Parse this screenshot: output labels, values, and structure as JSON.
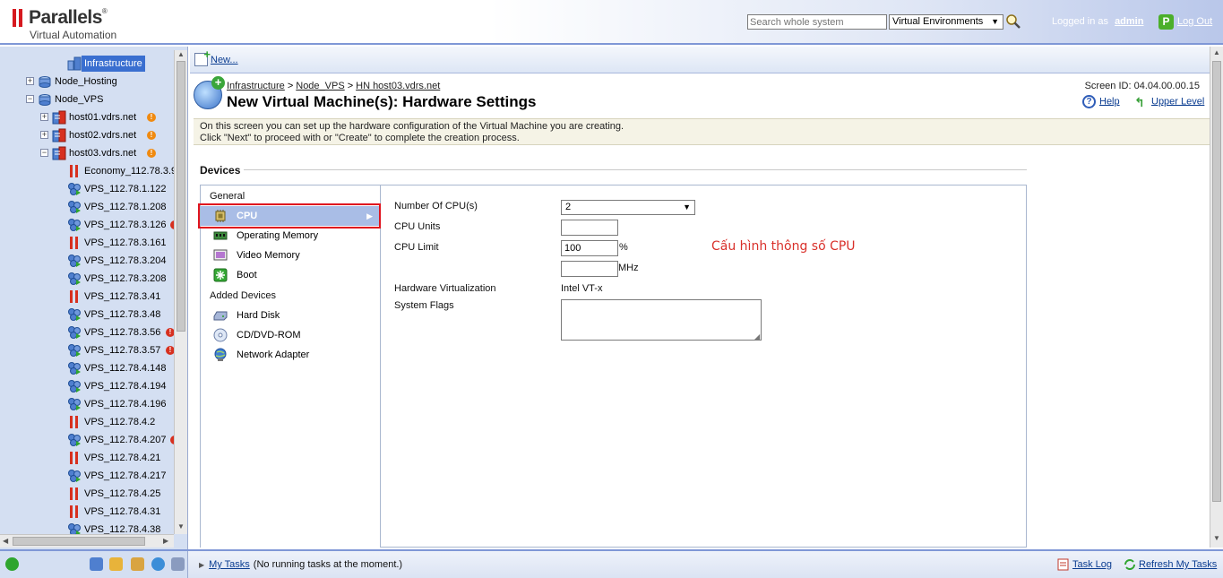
{
  "header": {
    "brand": "Parallels",
    "brand_mark": "®",
    "product": "Virtual Automation",
    "search_placeholder": "Search whole system",
    "search_scope": "Virtual Environments",
    "logged_in_label": "Logged in as",
    "user": "admin",
    "logout": "Log Out"
  },
  "sidebar": {
    "tree": [
      {
        "label": "Infrastructure",
        "selected": true
      },
      {
        "label": "Node_Hosting"
      },
      {
        "label": "Node_VPS"
      },
      {
        "label": "host01.vdrs.net",
        "badge": "warning"
      },
      {
        "label": "host02.vdrs.net",
        "badge": "warning"
      },
      {
        "label": "host03.vdrs.net",
        "badge": "warning"
      },
      {
        "label": "Economy_112.78.3.9",
        "status": "stopped"
      },
      {
        "label": "VPS_112.78.1.122",
        "status": "running"
      },
      {
        "label": "VPS_112.78.1.208",
        "status": "running"
      },
      {
        "label": "VPS_112.78.3.126",
        "status": "running"
      },
      {
        "label": "VPS_112.78.3.161",
        "status": "stopped"
      },
      {
        "label": "VPS_112.78.3.204",
        "status": "running"
      },
      {
        "label": "VPS_112.78.3.208",
        "status": "running"
      },
      {
        "label": "VPS_112.78.3.41",
        "status": "stopped"
      },
      {
        "label": "VPS_112.78.3.48",
        "status": "running"
      },
      {
        "label": "VPS_112.78.3.56",
        "status": "running"
      },
      {
        "label": "VPS_112.78.3.57",
        "status": "running"
      },
      {
        "label": "VPS_112.78.4.148",
        "status": "running"
      },
      {
        "label": "VPS_112.78.4.194",
        "status": "running"
      },
      {
        "label": "VPS_112.78.4.196",
        "status": "running"
      },
      {
        "label": "VPS_112.78.4.2",
        "status": "stopped"
      },
      {
        "label": "VPS_112.78.4.207",
        "status": "running"
      },
      {
        "label": "VPS_112.78.4.21",
        "status": "stopped"
      },
      {
        "label": "VPS_112.78.4.217",
        "status": "running"
      },
      {
        "label": "VPS_112.78.4.25",
        "status": "stopped"
      },
      {
        "label": "VPS_112.78.4.31",
        "status": "stopped"
      },
      {
        "label": "VPS_112.78.4.38",
        "status": "running"
      }
    ]
  },
  "toolbar": {
    "new_label": "New..."
  },
  "page": {
    "breadcrumb": [
      "Infrastructure",
      "Node_VPS",
      "HN host03.vdrs.net"
    ],
    "breadcrumb_sep": ">",
    "title": "New Virtual Machine(s): Hardware Settings",
    "screen_id": "Screen ID: 04.04.00.00.15",
    "help": "Help",
    "upper_level": "Upper Level",
    "description_line1": "On this screen you can set up the hardware configuration of the Virtual Machine you are creating.",
    "description_line2": "Click \"Next\" to proceed with or \"Create\" to complete the creation process."
  },
  "devices": {
    "title": "Devices",
    "group_general": "General",
    "group_added": "Added Devices",
    "general_items": [
      "CPU",
      "Operating Memory",
      "Video Memory",
      "Boot"
    ],
    "added_items": [
      "Hard Disk",
      "CD/DVD-ROM",
      "Network Adapter"
    ],
    "active_arrow": "▶"
  },
  "cpu_form": {
    "num_cpus_label": "Number Of CPU(s)",
    "num_cpus_value": "2",
    "cpu_units_label": "CPU Units",
    "cpu_units_value": "",
    "cpu_limit_label": "CPU Limit",
    "cpu_limit_value": "100",
    "cpu_limit_unit": "%",
    "cpu_mhz_value": "",
    "cpu_mhz_unit": "MHz",
    "hw_virt_label": "Hardware Virtualization",
    "hw_virt_value": "Intel VT-x",
    "system_flags_label": "System Flags",
    "annotation": "Cấu hình thông số CPU"
  },
  "bottom": {
    "my_tasks": "My Tasks",
    "tasks_status": "(No running tasks at the moment.)",
    "task_log": "Task Log",
    "refresh_tasks": "Refresh My Tasks"
  },
  "colors": {
    "accent": "#3a6fd0",
    "sidebar_bg": "#d4dff2",
    "highlight_box": "#e0141e",
    "annotation": "#d9302a"
  }
}
